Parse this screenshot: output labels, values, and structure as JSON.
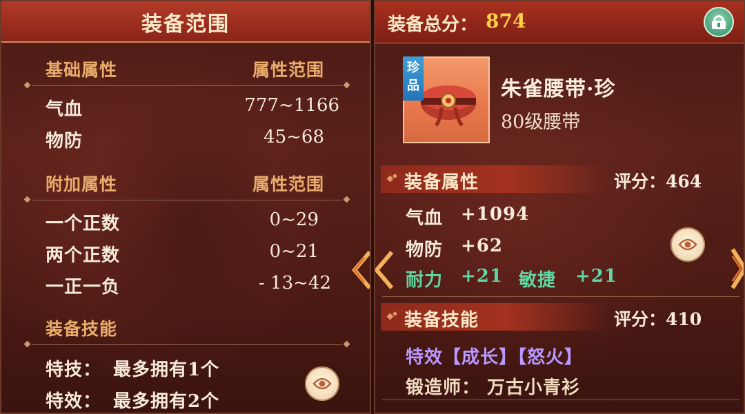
{
  "left": {
    "title": "装备范围",
    "base": {
      "header": "基础属性",
      "range_header": "属性范围",
      "rows": [
        {
          "label": "气血",
          "value": "777~1166"
        },
        {
          "label": "物防",
          "value": "45~68"
        }
      ]
    },
    "extra": {
      "header": "附加属性",
      "range_header": "属性范围",
      "rows": [
        {
          "label": "一个正数",
          "value": "0~29"
        },
        {
          "label": "两个正数",
          "value": "0~21"
        },
        {
          "label": "一正一负",
          "value": "- 13~42"
        }
      ]
    },
    "skills": {
      "header": "装备技能",
      "rows": [
        {
          "label": "特技：",
          "value": "最多拥有1个"
        },
        {
          "label": "特效：",
          "value": "最多拥有2个"
        }
      ]
    }
  },
  "right": {
    "score_label": "装备总分：",
    "score_value": "874",
    "item": {
      "rarity": "珍品",
      "name": "朱雀腰带·珍",
      "subtitle": "80级腰带"
    },
    "attributes": {
      "header": "装备属性",
      "score": "评分：464",
      "rows": [
        {
          "label": "气血",
          "value": "+1094"
        },
        {
          "label": "物防",
          "value": "+62"
        }
      ],
      "bonus": [
        {
          "label": "耐力",
          "value": "+21"
        },
        {
          "label": "敏捷",
          "value": "+21"
        }
      ]
    },
    "skills": {
      "header": "装备技能",
      "score": "评分：410",
      "effect": "特效【成长】【怒火】",
      "forger": "锻造师： 万古小青衫"
    }
  },
  "colors": {
    "header_red": "#a9301f",
    "score_gold": "#ffd24a",
    "section_tan": "#e8ad6c",
    "bonus_green": "#62d6a2",
    "effect_purple": "#b899ff"
  },
  "icons": [
    "eye-icon",
    "lock-icon",
    "chevron-left-icon",
    "chevron-right-icon",
    "belt-icon"
  ]
}
